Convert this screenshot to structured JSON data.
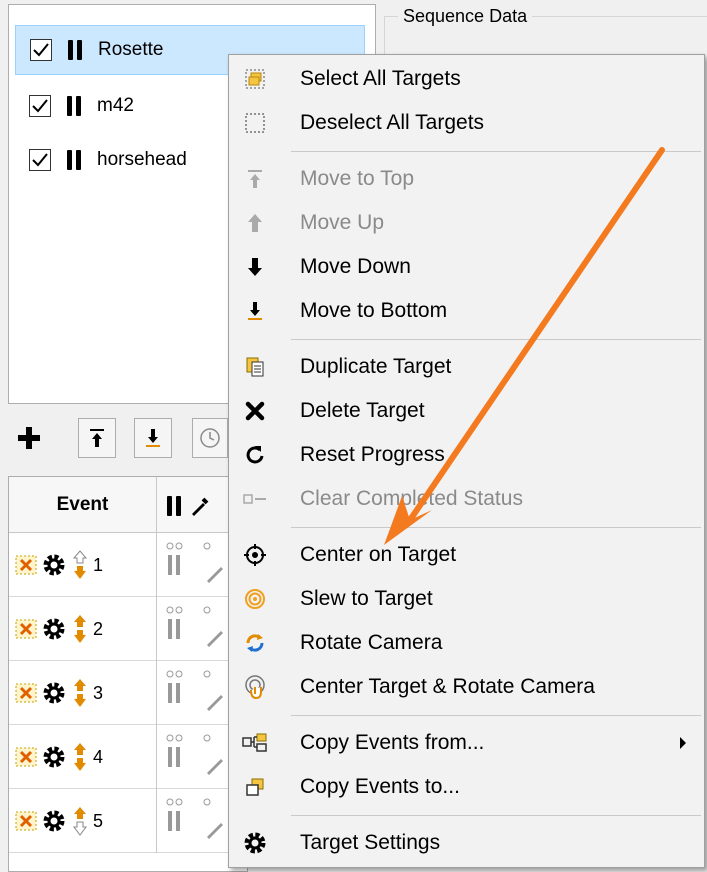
{
  "sequence_group": {
    "label": "Sequence Data"
  },
  "targets": [
    {
      "name": "Rosette",
      "checked": true,
      "selected": true
    },
    {
      "name": "m42",
      "checked": true,
      "selected": false
    },
    {
      "name": "horsehead",
      "checked": true,
      "selected": false
    }
  ],
  "toolbar": {
    "add_icon": "plus-icon",
    "top_icon": "arrow-to-top-icon",
    "bottom_icon": "arrow-to-bottom-icon",
    "clock_icon": "clock-icon"
  },
  "event_grid": {
    "header": "Event",
    "rows": [
      {
        "num": "1"
      },
      {
        "num": "2"
      },
      {
        "num": "3"
      },
      {
        "num": "4"
      },
      {
        "num": "5"
      }
    ]
  },
  "context_menu": {
    "items": [
      {
        "label": "Select All Targets",
        "icon": "select-all-icon",
        "enabled": true
      },
      {
        "label": "Deselect All Targets",
        "icon": "deselect-all-icon",
        "enabled": true
      },
      {
        "label": "Move to Top",
        "icon": "move-to-top-icon",
        "enabled": false
      },
      {
        "label": "Move Up",
        "icon": "move-up-icon",
        "enabled": false
      },
      {
        "label": "Move Down",
        "icon": "move-down-icon",
        "enabled": true
      },
      {
        "label": "Move to Bottom",
        "icon": "move-to-bottom-icon",
        "enabled": true
      },
      {
        "label": "Duplicate Target",
        "icon": "duplicate-icon",
        "enabled": true
      },
      {
        "label": "Delete Target",
        "icon": "delete-icon",
        "enabled": true
      },
      {
        "label": "Reset Progress",
        "icon": "reset-icon",
        "enabled": true
      },
      {
        "label": "Clear Completed Status",
        "icon": "clear-status-icon",
        "enabled": false
      },
      {
        "label": "Center on Target",
        "icon": "crosshair-icon",
        "enabled": true
      },
      {
        "label": "Slew to Target",
        "icon": "target-icon",
        "enabled": true
      },
      {
        "label": "Rotate Camera",
        "icon": "rotate-icon",
        "enabled": true
      },
      {
        "label": "Center Target & Rotate Camera",
        "icon": "center-rotate-icon",
        "enabled": true
      },
      {
        "label": "Copy Events from...",
        "icon": "copy-from-icon",
        "enabled": true,
        "submenu": true
      },
      {
        "label": "Copy Events to...",
        "icon": "copy-to-icon",
        "enabled": true
      },
      {
        "label": "Target Settings",
        "icon": "gear-icon",
        "enabled": true
      }
    ]
  },
  "colors": {
    "selection_bg": "#cce8ff",
    "annotation_arrow": "#f47a20",
    "arrow_orange": "#e38b00",
    "disabled_text": "#8a8a8a"
  }
}
